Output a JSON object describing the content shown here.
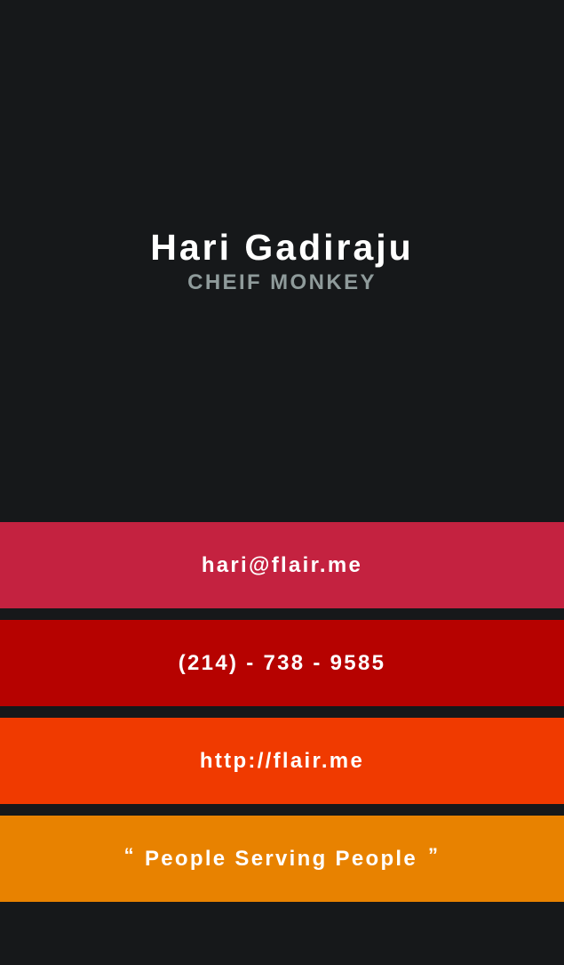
{
  "card": {
    "name": "Hari Gadiraju",
    "title": "CHEIF MONKEY"
  },
  "contacts": {
    "email": "hari@flair.me",
    "phone": "(214) - 738 - 9585",
    "website": "http://flair.me"
  },
  "tagline": {
    "open_quote": "“",
    "text": "People Serving People",
    "close_quote": "”"
  },
  "colors": {
    "background": "#16181a",
    "name_text": "#ffffff",
    "title_text": "#8f9b9b",
    "email_band": "#c42240",
    "phone_band": "#b60200",
    "website_band": "#f03a00",
    "tagline_band": "#e88200"
  }
}
